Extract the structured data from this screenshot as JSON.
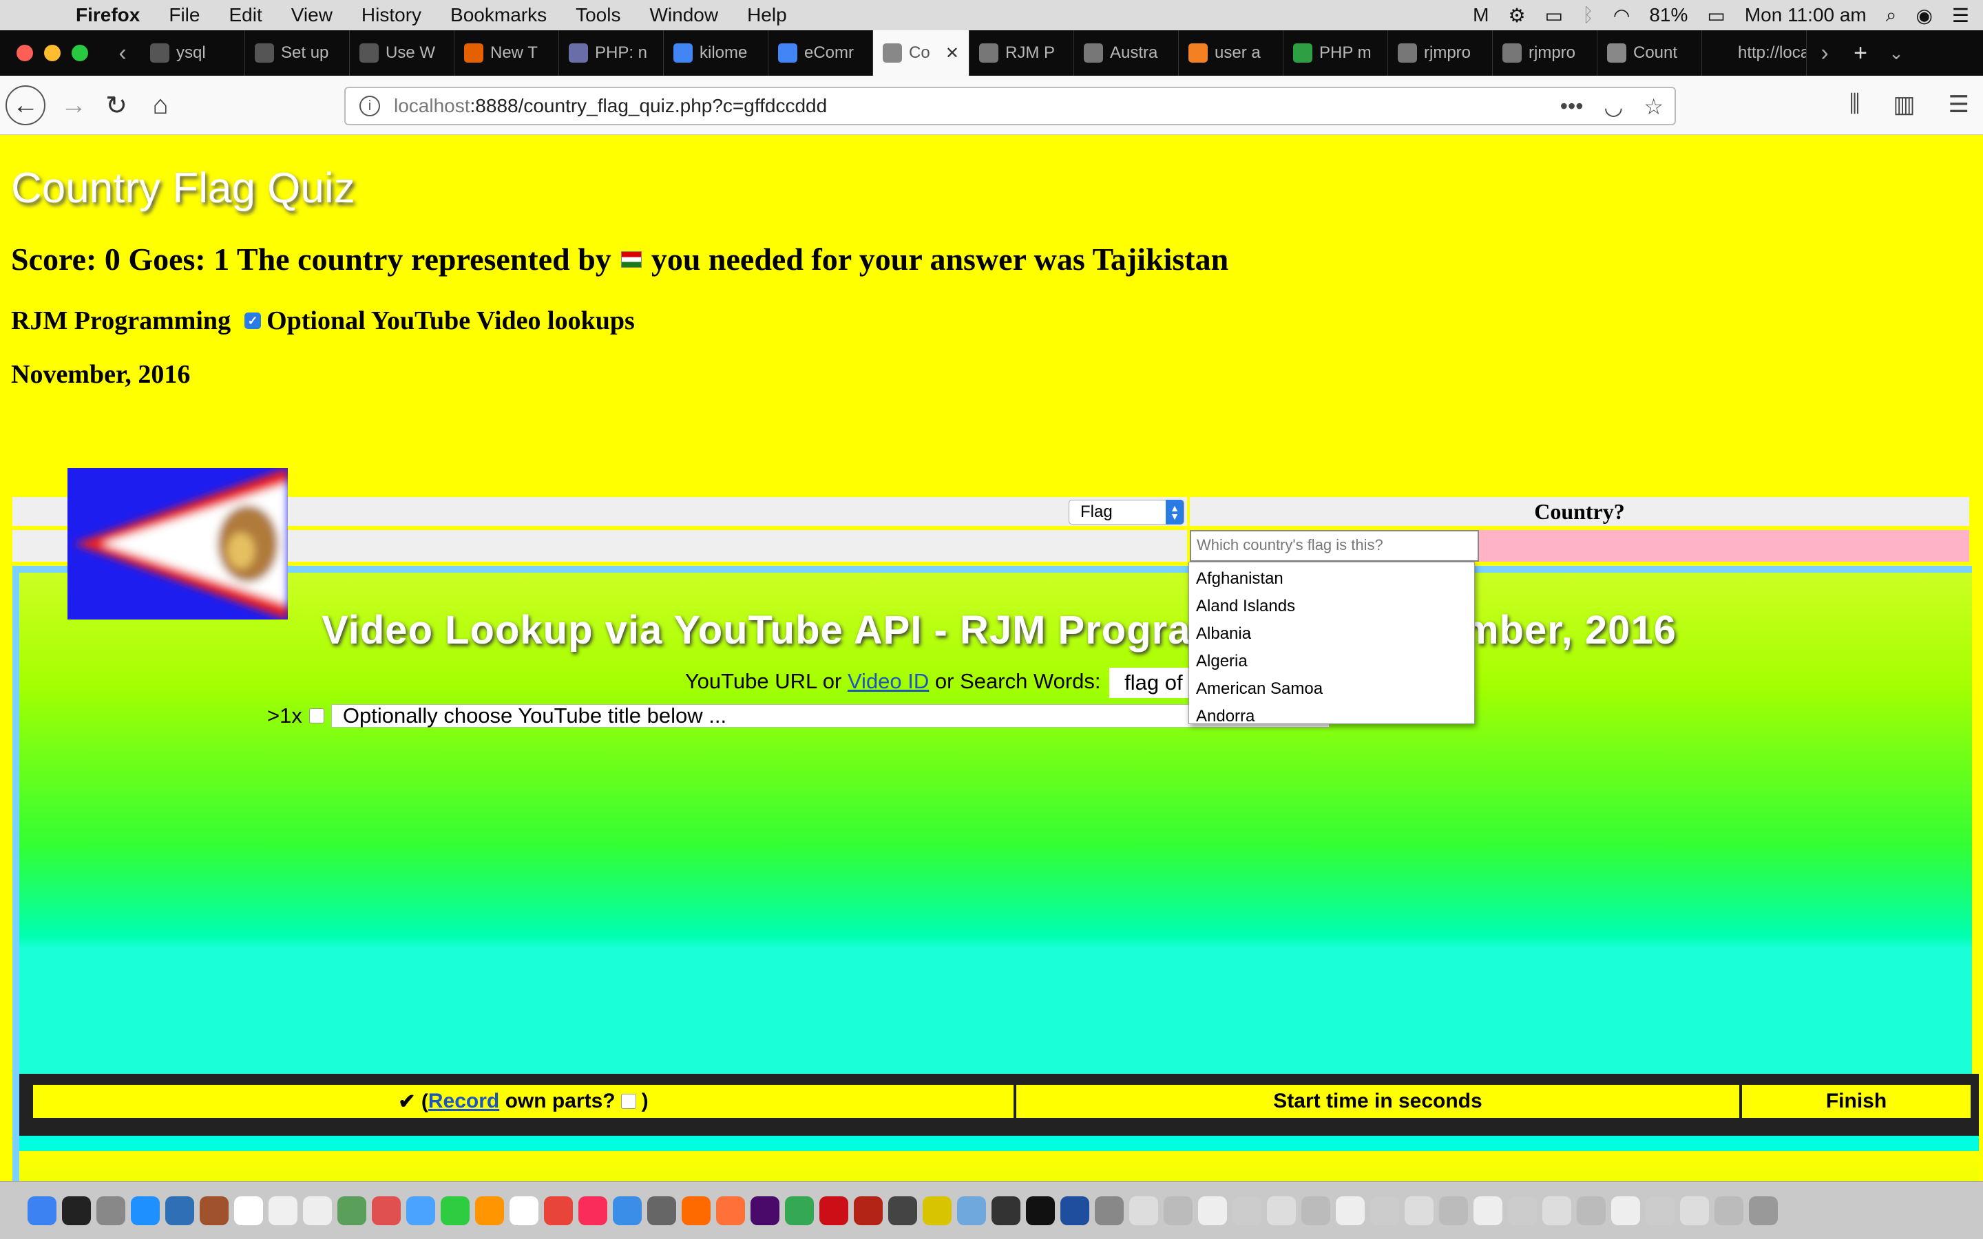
{
  "menubar": {
    "app": "Firefox",
    "items": [
      "File",
      "Edit",
      "View",
      "History",
      "Bookmarks",
      "Tools",
      "Window",
      "Help"
    ],
    "battery": "81%",
    "clock": "Mon 11:00 am"
  },
  "tabs": [
    {
      "label": "ysql",
      "color": "#555555"
    },
    {
      "label": "Set up",
      "color": "#555555"
    },
    {
      "label": "Use W",
      "color": "#555555"
    },
    {
      "label": "New T",
      "color": "#e66000"
    },
    {
      "label": "PHP: n",
      "color": "#6a6ea8"
    },
    {
      "label": "kilome",
      "color": "#4285f4"
    },
    {
      "label": "eComr",
      "color": "#4285f4"
    },
    {
      "label": "Co",
      "color": "#888888",
      "active": true
    },
    {
      "label": "RJM P",
      "color": "#777777"
    },
    {
      "label": "Austra",
      "color": "#777777"
    },
    {
      "label": "user a",
      "color": "#f48024"
    },
    {
      "label": "PHP m",
      "color": "#2ea043"
    },
    {
      "label": "rjmpro",
      "color": "#777777"
    },
    {
      "label": "rjmpro",
      "color": "#777777"
    },
    {
      "label": "Count",
      "color": "#888888"
    },
    {
      "label": "http://loca",
      "color": "#0c0c0d"
    }
  ],
  "address": {
    "host": "localhost",
    "rest": ":8888/country_flag_quiz.php?c=gffdccddd"
  },
  "page": {
    "title": "Country Flag Quiz",
    "score_text_before": "Score: 0 Goes: 1 The country represented by",
    "score_text_after": "you needed for your answer was Tajikistan",
    "rjm": "RJM Programming",
    "youtube_option": "Optional YouTube Video lookups",
    "date": "November, 2016",
    "flag_select_value": "Flag",
    "country_header": "Country?",
    "country_placeholder": "Which country's flag is this?",
    "country_options": [
      "Afghanistan",
      "Aland Islands",
      "Albania",
      "Algeria",
      "American Samoa",
      "Andorra"
    ]
  },
  "video": {
    "title": "Video Lookup via YouTube API - RJM Programming - November, 2016",
    "url_label_1": "YouTube URL or",
    "video_id_link": "Video ID",
    "url_label_2": "or Search Words:",
    "search_value": "flag of Tajikistan",
    "multi_label": ">1x",
    "title_select": "Optionally choose YouTube title below ...",
    "record_prefix": "✔ (",
    "record_link": "Record",
    "record_suffix": "own parts?",
    "record_close": ")",
    "start_time": "Start time in seconds",
    "finish": "Finish"
  },
  "dock_colors": [
    "#3d82f2",
    "#222222",
    "#888888",
    "#1e90ff",
    "#2f6fb5",
    "#a0522d",
    "#ffffff",
    "#f0f0f0",
    "#eeeeee",
    "#5aa05a",
    "#e05050",
    "#4aa3ff",
    "#2ecc40",
    "#ff9500",
    "#ffffff",
    "#e8443a",
    "#fa2c5a",
    "#3a8ee6",
    "#666666",
    "#ff6a00",
    "#ff7139",
    "#4a0a6a",
    "#34a853",
    "#cc0f16",
    "#b32416",
    "#444444",
    "#d8c400",
    "#6fa8dc",
    "#333333",
    "#111111",
    "#1f4e9e",
    "#888888",
    "#dddddd",
    "#bbbbbb",
    "#eeeeee",
    "#cccccc",
    "#dddddd",
    "#bbbbbb",
    "#eeeeee",
    "#cccccc",
    "#dddddd",
    "#bbbbbb",
    "#eeeeee",
    "#cccccc",
    "#dddddd",
    "#bbbbbb",
    "#eeeeee",
    "#cccccc",
    "#dddddd",
    "#bbbbbb",
    "#999999"
  ]
}
